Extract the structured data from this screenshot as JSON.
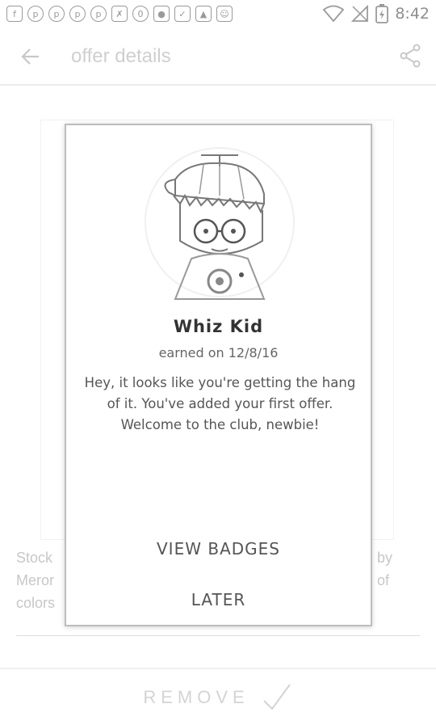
{
  "status_bar": {
    "time": "8:42",
    "notification_icons": [
      "facebook-icon",
      "pinterest-icon",
      "pinterest-icon",
      "pinterest-icon",
      "pinterest-icon",
      "app-icon",
      "app-icon",
      "app-icon",
      "app-icon",
      "app-icon",
      "app-icon"
    ],
    "right_icons": [
      "wifi-icon",
      "no-signal-icon",
      "battery-charging-icon"
    ]
  },
  "app_bar": {
    "title": "offer details",
    "back_icon": "arrow-left-icon",
    "share_icon": "share-icon"
  },
  "background": {
    "text_left_1": "Stock",
    "text_left_2": "Meror",
    "text_left_3": "colors",
    "text_right_1": "by",
    "text_right_2": "of",
    "remove_label": "REMOVE",
    "check_icon": "checkmark-icon"
  },
  "modal": {
    "badge_name": "Whiz Kid",
    "earned_text": "earned on 12/8/16",
    "message": "Hey, it looks like you're getting the hang of it. You've added your first offer. Welcome to the club, newbie!",
    "view_badges_label": "VIEW BADGES",
    "later_label": "LATER",
    "badge_icon": "whiz-kid-badge-icon"
  },
  "colors": {
    "modal_border": "#bdbdbd",
    "title_faded": "#cfcfcf",
    "text_dark": "#333333"
  }
}
